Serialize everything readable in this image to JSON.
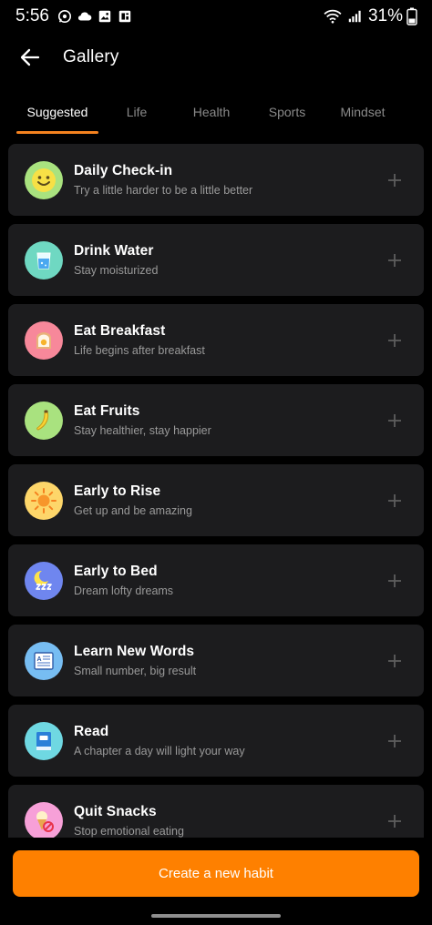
{
  "status_bar": {
    "time": "5:56",
    "battery": "31%"
  },
  "header": {
    "title": "Gallery"
  },
  "tabs": [
    {
      "label": "Suggested",
      "active": true
    },
    {
      "label": "Life",
      "active": false
    },
    {
      "label": "Health",
      "active": false
    },
    {
      "label": "Sports",
      "active": false
    },
    {
      "label": "Mindset",
      "active": false
    }
  ],
  "habits": [
    {
      "title": "Daily Check-in",
      "subtitle": "Try a little harder to be a little better",
      "icon": "smiley-face-icon",
      "icon_bg": "#a9e27f"
    },
    {
      "title": "Drink Water",
      "subtitle": "Stay moisturized",
      "icon": "water-glass-icon",
      "icon_bg": "#6fd8c2"
    },
    {
      "title": "Eat Breakfast",
      "subtitle": "Life begins after breakfast",
      "icon": "toast-egg-icon",
      "icon_bg": "#f7889a"
    },
    {
      "title": "Eat Fruits",
      "subtitle": "Stay healthier, stay happier",
      "icon": "banana-icon",
      "icon_bg": "#a9e27f"
    },
    {
      "title": "Early to Rise",
      "subtitle": "Get up and be amazing",
      "icon": "sun-icon",
      "icon_bg": "#fdd66a"
    },
    {
      "title": "Early to Bed",
      "subtitle": "Dream lofty dreams",
      "icon": "moon-sleep-icon",
      "icon_bg": "#6f86ef"
    },
    {
      "title": "Learn New Words",
      "subtitle": "Small number, big result",
      "icon": "book-words-icon",
      "icon_bg": "#77bdf2"
    },
    {
      "title": "Read",
      "subtitle": "A chapter a day will light your way",
      "icon": "book-icon",
      "icon_bg": "#6fd8e2"
    },
    {
      "title": "Quit Snacks",
      "subtitle": "Stop emotional eating",
      "icon": "no-ice-cream-icon",
      "icon_bg": "#f7a0d8"
    }
  ],
  "create_button": {
    "label": "Create a new habit"
  },
  "colors": {
    "accent": "#fe8000",
    "card": "#1c1c1e",
    "background": "#000000"
  }
}
